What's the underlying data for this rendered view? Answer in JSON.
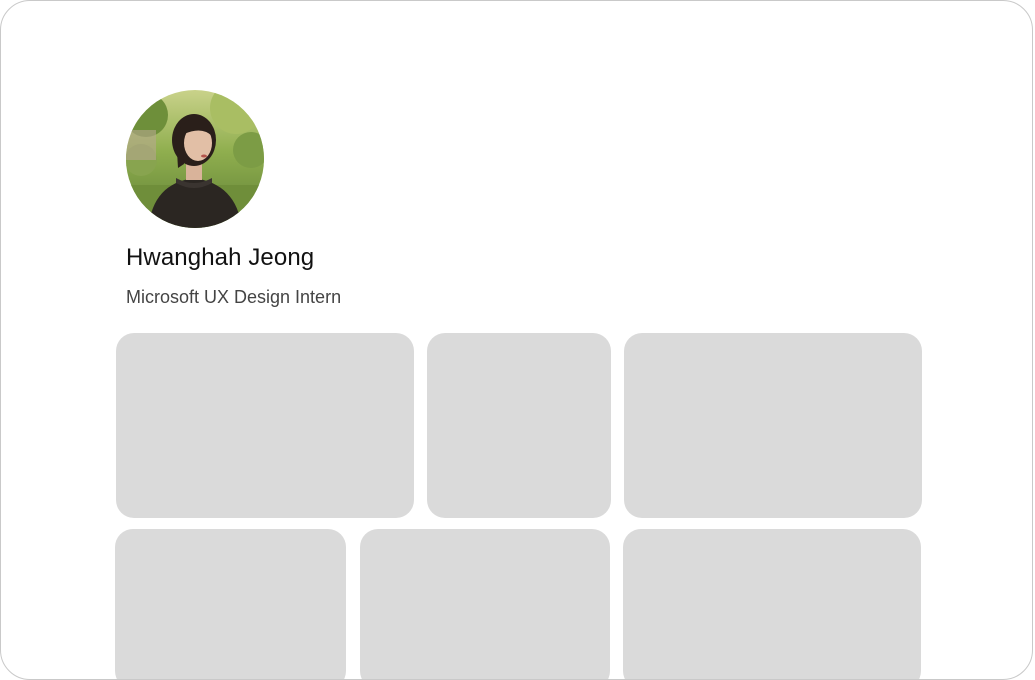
{
  "profile": {
    "name": "Hwanghah Jeong",
    "title": "Microsoft UX Design Intern",
    "avatar": "profile-photo"
  },
  "cards": [
    {
      "id": "card-1"
    },
    {
      "id": "card-2"
    },
    {
      "id": "card-3"
    },
    {
      "id": "card-4"
    },
    {
      "id": "card-5"
    },
    {
      "id": "card-6"
    }
  ],
  "colors": {
    "card_placeholder": "#dadada",
    "border": "#c9c9c9",
    "name_text": "#111111",
    "title_text": "#444444"
  }
}
